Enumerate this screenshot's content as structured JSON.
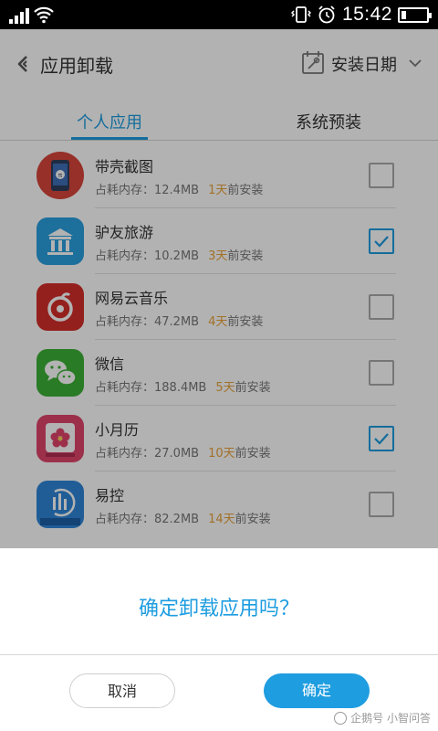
{
  "status_bar": {
    "time": "15:42"
  },
  "header": {
    "title": "应用卸载",
    "sort_label": "安装日期"
  },
  "tabs": [
    {
      "label": "个人应用",
      "active": true
    },
    {
      "label": "系统预装",
      "active": false
    }
  ],
  "apps": [
    {
      "name": "带壳截图",
      "memory": "占耗内存：12.4MB",
      "days": "1天",
      "suffix": "前安装",
      "checked": false,
      "icon": "phone-screenshot-icon"
    },
    {
      "name": "驴友旅游",
      "memory": "占耗内存：10.2MB",
      "days": "3天",
      "suffix": "前安装",
      "checked": true,
      "icon": "temple-icon"
    },
    {
      "name": "网易云音乐",
      "memory": "占耗内存：47.2MB",
      "days": "4天",
      "suffix": "前安装",
      "checked": false,
      "icon": "music-note-icon"
    },
    {
      "name": "微信",
      "memory": "占耗内存：188.4MB",
      "days": "5天",
      "suffix": "前安装",
      "checked": false,
      "icon": "chat-bubbles-icon"
    },
    {
      "name": "小月历",
      "memory": "占耗内存：27.0MB",
      "days": "10天",
      "suffix": "前安装",
      "checked": true,
      "icon": "flower-calendar-icon"
    },
    {
      "name": "易控",
      "memory": "占耗内存：82.2MB",
      "days": "14天",
      "suffix": "前安装",
      "checked": false,
      "icon": "broadlink-icon"
    }
  ],
  "dialog": {
    "message": "确定卸载应用吗？",
    "cancel_label": "取消",
    "confirm_label": "确定"
  },
  "watermark": "企鹅号 小智问答",
  "colors": {
    "accent": "#1e9de0",
    "days": "#e8a33a"
  }
}
